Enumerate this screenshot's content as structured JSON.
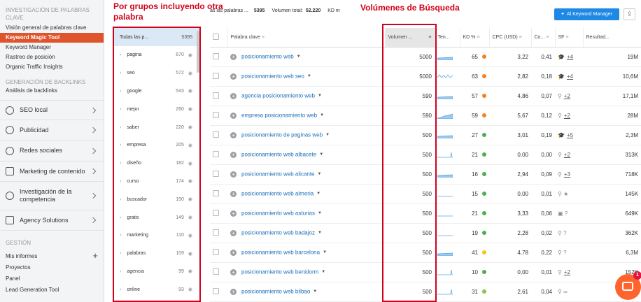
{
  "sidebar": {
    "top_section_header": "INVESTIGACIÓN DE PALABRAS CLAVE",
    "top_links": [
      {
        "label": "Visión general de palabras clave",
        "active": false
      },
      {
        "label": "Keyword Magic Tool",
        "active": true
      },
      {
        "label": "Keyword Manager",
        "active": false
      },
      {
        "label": "Rastreo de posición",
        "active": false
      },
      {
        "label": "Organic Traffic Insights",
        "active": false
      }
    ],
    "backlinks_header": "GENERACIÓN DE BACKLINKS",
    "backlinks_links": [
      {
        "label": "Análisis de backlinks"
      }
    ],
    "sections": [
      {
        "label": "SEO local",
        "icon": "location-pin-icon"
      },
      {
        "label": "Publicidad",
        "icon": "megaphone-icon"
      },
      {
        "label": "Redes sociales",
        "icon": "chat-bubble-icon"
      },
      {
        "label": "Marketing de contenido",
        "icon": "pencil-icon"
      },
      {
        "label": "Investigación de la competencia",
        "icon": "compass-icon"
      },
      {
        "label": "Agency Solutions",
        "icon": "document-icon"
      }
    ],
    "gestion_header": "GESTIÓN",
    "gestion_links": [
      {
        "label": "Mis informes"
      },
      {
        "label": "Proyectos"
      },
      {
        "label": "Panel"
      },
      {
        "label": "Lead Generation Tool"
      }
    ]
  },
  "annotations": {
    "groups": "Por grupos incluyendo otra palabra",
    "volumes": "Volúmenes de Búsqueda"
  },
  "topbar": {
    "keywords_label": "as las palabras ...",
    "keywords_count": "5395",
    "volume_label": "Volumen total:",
    "volume_value": "52.220",
    "kd_label": "KD m",
    "add_button": "Al Keyword Manager"
  },
  "groups": {
    "all_label": "Todas las p...",
    "all_count": "5395",
    "items": [
      {
        "name": "pagina",
        "count": "670"
      },
      {
        "name": "seo",
        "count": "572"
      },
      {
        "name": "google",
        "count": "543"
      },
      {
        "name": "mejor",
        "count": "260"
      },
      {
        "name": "saber",
        "count": "220"
      },
      {
        "name": "empresa",
        "count": "205"
      },
      {
        "name": "diseño",
        "count": "182"
      },
      {
        "name": "curso",
        "count": "174"
      },
      {
        "name": "buscador",
        "count": "150"
      },
      {
        "name": "gratis",
        "count": "149"
      },
      {
        "name": "marketing",
        "count": "110"
      },
      {
        "name": "palabras",
        "count": "109"
      },
      {
        "name": "agencia",
        "count": "99"
      },
      {
        "name": "online",
        "count": "93"
      }
    ]
  },
  "table": {
    "headers": [
      "Palabra clave",
      "Volumen ...",
      "Ten...",
      "KD %",
      "CPC (USD)",
      "Co...",
      "SF",
      "Resultad..."
    ],
    "rows": [
      {
        "keyword": "posicionamiento web",
        "volume": "5000",
        "trend": "flat",
        "kd": "65",
        "kd_color": "#f5821f",
        "cpc": "3,22",
        "com": "0,41",
        "sf_icon": "cap-icon",
        "sf_extra": "+4",
        "results": "19M"
      },
      {
        "keyword": "posicionamiento web seo",
        "volume": "5000",
        "trend": "wave",
        "kd": "63",
        "kd_color": "#f5821f",
        "cpc": "2,82",
        "com": "0,18",
        "sf_icon": "cap-icon",
        "sf_extra": "+4",
        "results": "10,6M"
      },
      {
        "keyword": "agencia posicionamiento web",
        "volume": "590",
        "trend": "flat",
        "kd": "57",
        "kd_color": "#f5821f",
        "cpc": "4,86",
        "com": "0,07",
        "sf_icon": "pin-icon",
        "sf_extra": "+2",
        "results": "17,1M"
      },
      {
        "keyword": "empresa posicionamiento web",
        "volume": "590",
        "trend": "rise",
        "kd": "59",
        "kd_color": "#f5821f",
        "cpc": "5,67",
        "com": "0,12",
        "sf_icon": "pin-icon",
        "sf_extra": "+2",
        "results": "28M"
      },
      {
        "keyword": "posicionamiento de paginas web",
        "volume": "500",
        "trend": "flat",
        "kd": "27",
        "kd_color": "#4caf50",
        "cpc": "3,01",
        "com": "0,19",
        "sf_icon": "cap-icon",
        "sf_extra": "+5",
        "results": "2,3M"
      },
      {
        "keyword": "posicionamiento web albacete",
        "volume": "500",
        "trend": "spike",
        "kd": "21",
        "kd_color": "#4caf50",
        "cpc": "0,00",
        "com": "0,00",
        "sf_icon": "pin-icon",
        "sf_extra": "+2",
        "results": "313K"
      },
      {
        "keyword": "posicionamiento web alicante",
        "volume": "500",
        "trend": "flat",
        "kd": "16",
        "kd_color": "#4caf50",
        "cpc": "2,94",
        "com": "0,09",
        "sf_icon": "pin-icon",
        "sf_extra": "+3",
        "results": "718K"
      },
      {
        "keyword": "posicionamiento web almeria",
        "volume": "500",
        "trend": "line",
        "kd": "15",
        "kd_color": "#4caf50",
        "cpc": "0,00",
        "com": "0,01",
        "sf_icon": "pin-star-icon",
        "sf_extra": "",
        "results": "145K"
      },
      {
        "keyword": "posicionamiento web asturias",
        "volume": "500",
        "trend": "line",
        "kd": "21",
        "kd_color": "#4caf50",
        "cpc": "3,33",
        "com": "0,06",
        "sf_icon": "video-question-icon",
        "sf_extra": "",
        "results": "649K"
      },
      {
        "keyword": "posicionamiento web badajoz",
        "volume": "500",
        "trend": "line",
        "kd": "19",
        "kd_color": "#4caf50",
        "cpc": "2,28",
        "com": "0,02",
        "sf_icon": "pin-question-icon",
        "sf_extra": "",
        "results": "362K"
      },
      {
        "keyword": "posicionamiento web barcelona",
        "volume": "500",
        "trend": "flat",
        "kd": "41",
        "kd_color": "#f5c518",
        "cpc": "4,78",
        "com": "0,22",
        "sf_icon": "pin-question-icon",
        "sf_extra": "",
        "results": "6,3M"
      },
      {
        "keyword": "posicionamiento web benidorm",
        "volume": "500",
        "trend": "spike",
        "kd": "10",
        "kd_color": "#4caf50",
        "cpc": "0,00",
        "com": "0,01",
        "sf_icon": "pin-icon",
        "sf_extra": "+2",
        "results": "152K"
      },
      {
        "keyword": "posicionamiento web bilbao",
        "volume": "500",
        "trend": "spike",
        "kd": "31",
        "kd_color": "#8bc34a",
        "cpc": "2,61",
        "com": "0,04",
        "sf_icon": "pin-link-icon",
        "sf_extra": "",
        "results": "744"
      }
    ]
  },
  "chat": {
    "badge": "1"
  }
}
